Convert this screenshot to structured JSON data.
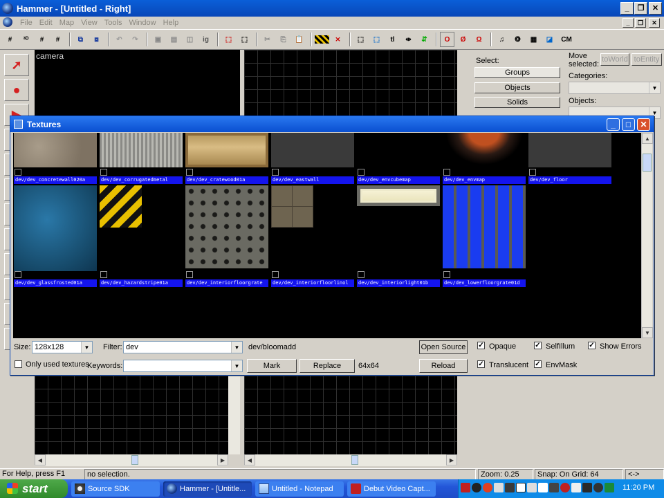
{
  "app": {
    "title": "Hammer - [Untitled - Right]",
    "window_controls": [
      "minimize",
      "restore",
      "close"
    ]
  },
  "menu": [
    "File",
    "Edit",
    "Map",
    "View",
    "Tools",
    "Window",
    "Help"
  ],
  "toolbar": {
    "snap_label": "CM",
    "icons": [
      "grid-icon",
      "3d-grid-icon",
      "grid-smaller-icon",
      "grid-larger-icon",
      "group-icon",
      "ungroup-icon",
      "undo-icon",
      "redo-icon",
      "carve-icon",
      "hollow-icon",
      "to-world-icon",
      "ignore-group-icon",
      "cut-icon",
      "copy-icon",
      "paste-icon",
      "texture-lock-icon",
      "texture-scale-lock-icon",
      "select-icon",
      "snap-icon",
      "text-icon",
      "flip-h-icon",
      "flip-v-icon",
      "compile-icon",
      "run-map-icon",
      "check-map-icon",
      "sound-icon",
      "pointfile-icon",
      "helper-icon",
      "displacement-icon",
      "cordon-icon"
    ]
  },
  "viewport": {
    "camera_label": "camera"
  },
  "right_panel": {
    "select_label": "Select:",
    "select_buttons": [
      "Groups",
      "Objects",
      "Solids"
    ],
    "move_selected_label": "Move selected:",
    "to_world": "toWorld",
    "to_entity": "toEntity",
    "categories_label": "Categories:",
    "objects_label": "Objects:"
  },
  "textures_dialog": {
    "title": "Textures",
    "row1": [
      {
        "name": "dev/dev_concretewall020a",
        "swatch": "concrete"
      },
      {
        "name": "dev/dev_corrugatedmetal",
        "swatch": "metal"
      },
      {
        "name": "dev/dev_cratewood01a",
        "swatch": "wood"
      },
      {
        "name": "dev/dev_eastwall",
        "swatch": "dark"
      },
      {
        "name": "dev/dev_envcubemap",
        "swatch": "black"
      },
      {
        "name": "dev/dev_envmap",
        "swatch": "envmap"
      },
      {
        "name": "dev/dev_floor",
        "swatch": "dark"
      }
    ],
    "row2": [
      {
        "name": "dev/dev_glassfrosted01a",
        "swatch": "glass"
      },
      {
        "name": "dev/dev_hazardstripe01a",
        "swatch": "hazard"
      },
      {
        "name": "dev/dev_interiorfloorgrate",
        "swatch": "grate"
      },
      {
        "name": "dev/dev_interiorfloorlinol",
        "swatch": "tile"
      },
      {
        "name": "dev/dev_interiorlight01b",
        "swatch": "light"
      },
      {
        "name": "dev/dev_lowerfloorgrate01d",
        "swatch": "bluegrate"
      }
    ],
    "size_label": "Size:",
    "size_value": "128x128",
    "filter_label": "Filter:",
    "filter_value": "dev",
    "selected_texture": "dev/bloomadd",
    "selected_size": "64x64",
    "only_used_label": "Only used textures",
    "keywords_label": "Keywords:",
    "keywords_value": "",
    "mark_button": "Mark",
    "replace_button": "Replace",
    "open_source_button": "Open Source",
    "reload_button": "Reload",
    "checkboxes": {
      "opaque": {
        "label": "Opaque",
        "checked": true
      },
      "selfillum": {
        "label": "SelfIllum",
        "checked": true
      },
      "show_errors": {
        "label": "Show Errors",
        "checked": true
      },
      "translucent": {
        "label": "Translucent",
        "checked": true
      },
      "envmask": {
        "label": "EnvMask",
        "checked": true
      }
    },
    "only_used_checked": false
  },
  "statusbar": {
    "help": "For Help, press F1",
    "selection": "no selection.",
    "zoom": "Zoom: 0.25",
    "snap": "Snap: On Grid: 64",
    "arrows": "<->"
  },
  "taskbar": {
    "start": "start",
    "tasks": [
      "Source SDK",
      "Hammer - [Untitle...",
      "Untitled - Notepad",
      "Debut Video Capt..."
    ],
    "clock": "11:20 PM"
  }
}
